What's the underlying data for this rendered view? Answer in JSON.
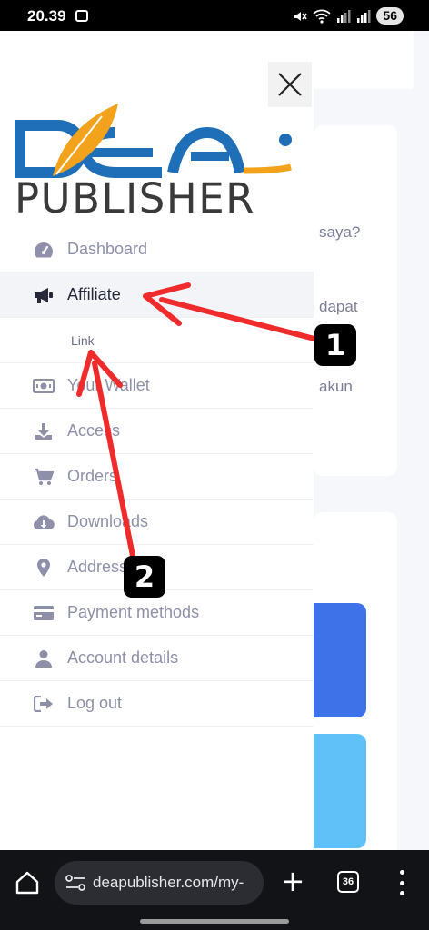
{
  "status_bar": {
    "time": "20.39",
    "battery": "56"
  },
  "background_page": {
    "text_lines": [
      "saya?",
      "dapat",
      "akun"
    ]
  },
  "drawer": {
    "logo": {
      "top_text": "DEA",
      "bottom_text": "PUBLISHER"
    },
    "menu": [
      {
        "label": "Dashboard",
        "icon": "dashboard-gauge-icon"
      },
      {
        "label": "Affiliate",
        "icon": "megaphone-icon",
        "active": true
      },
      {
        "label": "Link",
        "submenu": true
      },
      {
        "label": "Your Wallet",
        "icon": "money-icon"
      },
      {
        "label": "Access",
        "icon": "download-tray-icon"
      },
      {
        "label": "Orders",
        "icon": "cart-icon"
      },
      {
        "label": "Downloads",
        "icon": "cloud-download-icon"
      },
      {
        "label": "Addresses",
        "icon": "map-pin-icon"
      },
      {
        "label": "Payment methods",
        "icon": "credit-card-icon"
      },
      {
        "label": "Account details",
        "icon": "user-icon"
      },
      {
        "label": "Log out",
        "icon": "logout-icon"
      }
    ]
  },
  "annotations": [
    {
      "label": "1",
      "points_to": "Affiliate"
    },
    {
      "label": "2",
      "points_to": "Link"
    }
  ],
  "browser": {
    "url": "deapublisher.com/my-",
    "tab_count": "36"
  },
  "colors": {
    "accent_blue": "#1f6fb8",
    "accent_orange": "#f3a21c",
    "annotation_red": "#ef2b2b",
    "menu_text": "#8d90a8"
  }
}
